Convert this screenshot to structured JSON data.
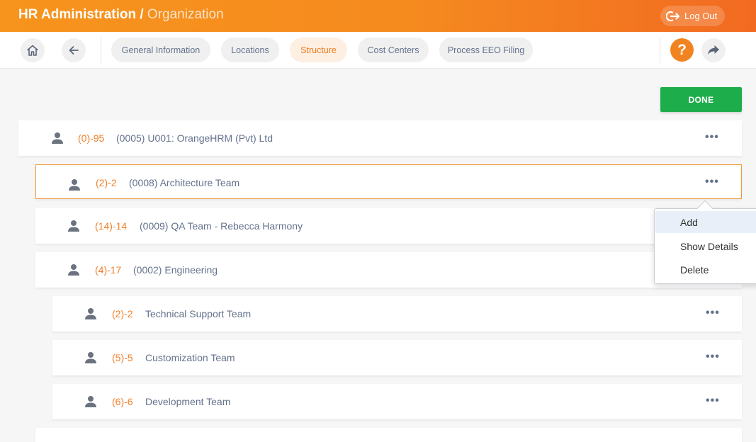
{
  "header": {
    "title_main": "HR Administration /",
    "title_sub": "Organization",
    "logout_label": "Log Out"
  },
  "nav": {
    "tabs": [
      {
        "label": "General Information"
      },
      {
        "label": "Locations"
      },
      {
        "label": "Structure"
      },
      {
        "label": "Cost Centers"
      },
      {
        "label": "Process EEO Filing"
      }
    ],
    "help_label": "?"
  },
  "actions": {
    "done_label": "DONE"
  },
  "tree": {
    "nodes": [
      {
        "count": "(0)-95",
        "name": "(0005) U001: OrangeHRM (Pvt) Ltd"
      },
      {
        "count": "(2)-2",
        "name": "(0008) Architecture Team"
      },
      {
        "count": "(14)-14",
        "name": "(0009) QA Team - Rebecca Harmony"
      },
      {
        "count": "(4)-17",
        "name": "(0002) Engineering"
      },
      {
        "count": "(2)-2",
        "name": "Technical Support Team"
      },
      {
        "count": "(5)-5",
        "name": "Customization Team"
      },
      {
        "count": "(6)-6",
        "name": "Development Team"
      }
    ],
    "more_symbol": "•••"
  },
  "context_menu": {
    "items": [
      {
        "label": "Add"
      },
      {
        "label": "Show Details"
      },
      {
        "label": "Delete"
      }
    ]
  },
  "colors": {
    "accent": "#f18421",
    "done": "#1ead4b",
    "count": "#f07f2a"
  }
}
